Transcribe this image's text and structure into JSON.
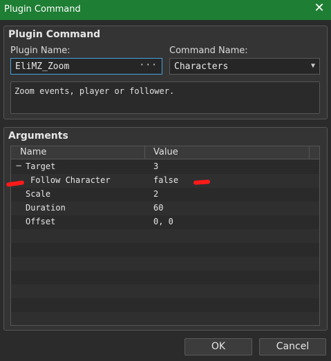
{
  "window": {
    "title": "Plugin Command",
    "close_glyph": "✕"
  },
  "plugin_group": {
    "title": "Plugin Command",
    "plugin_name_label": "Plugin Name:",
    "plugin_name_value": "EliMZ_Zoom",
    "browse_glyph": "···",
    "command_name_label": "Command Name:",
    "command_name_value": "Characters",
    "description": "Zoom events, player or follower."
  },
  "arguments": {
    "title": "Arguments",
    "columns": [
      "Name",
      "Value"
    ],
    "rows": [
      {
        "name": "Target",
        "value": "3",
        "toggle": "−"
      },
      {
        "name": "Follow Character",
        "value": "false"
      },
      {
        "name": "Scale",
        "value": "2"
      },
      {
        "name": "Duration",
        "value": "60"
      },
      {
        "name": "Offset",
        "value": "0, 0"
      }
    ]
  },
  "buttons": {
    "ok": "OK",
    "cancel": "Cancel"
  },
  "colors": {
    "titlebar": "#1e7e34",
    "annotation": "#ff1a1a",
    "focus": "#4aa3df"
  }
}
